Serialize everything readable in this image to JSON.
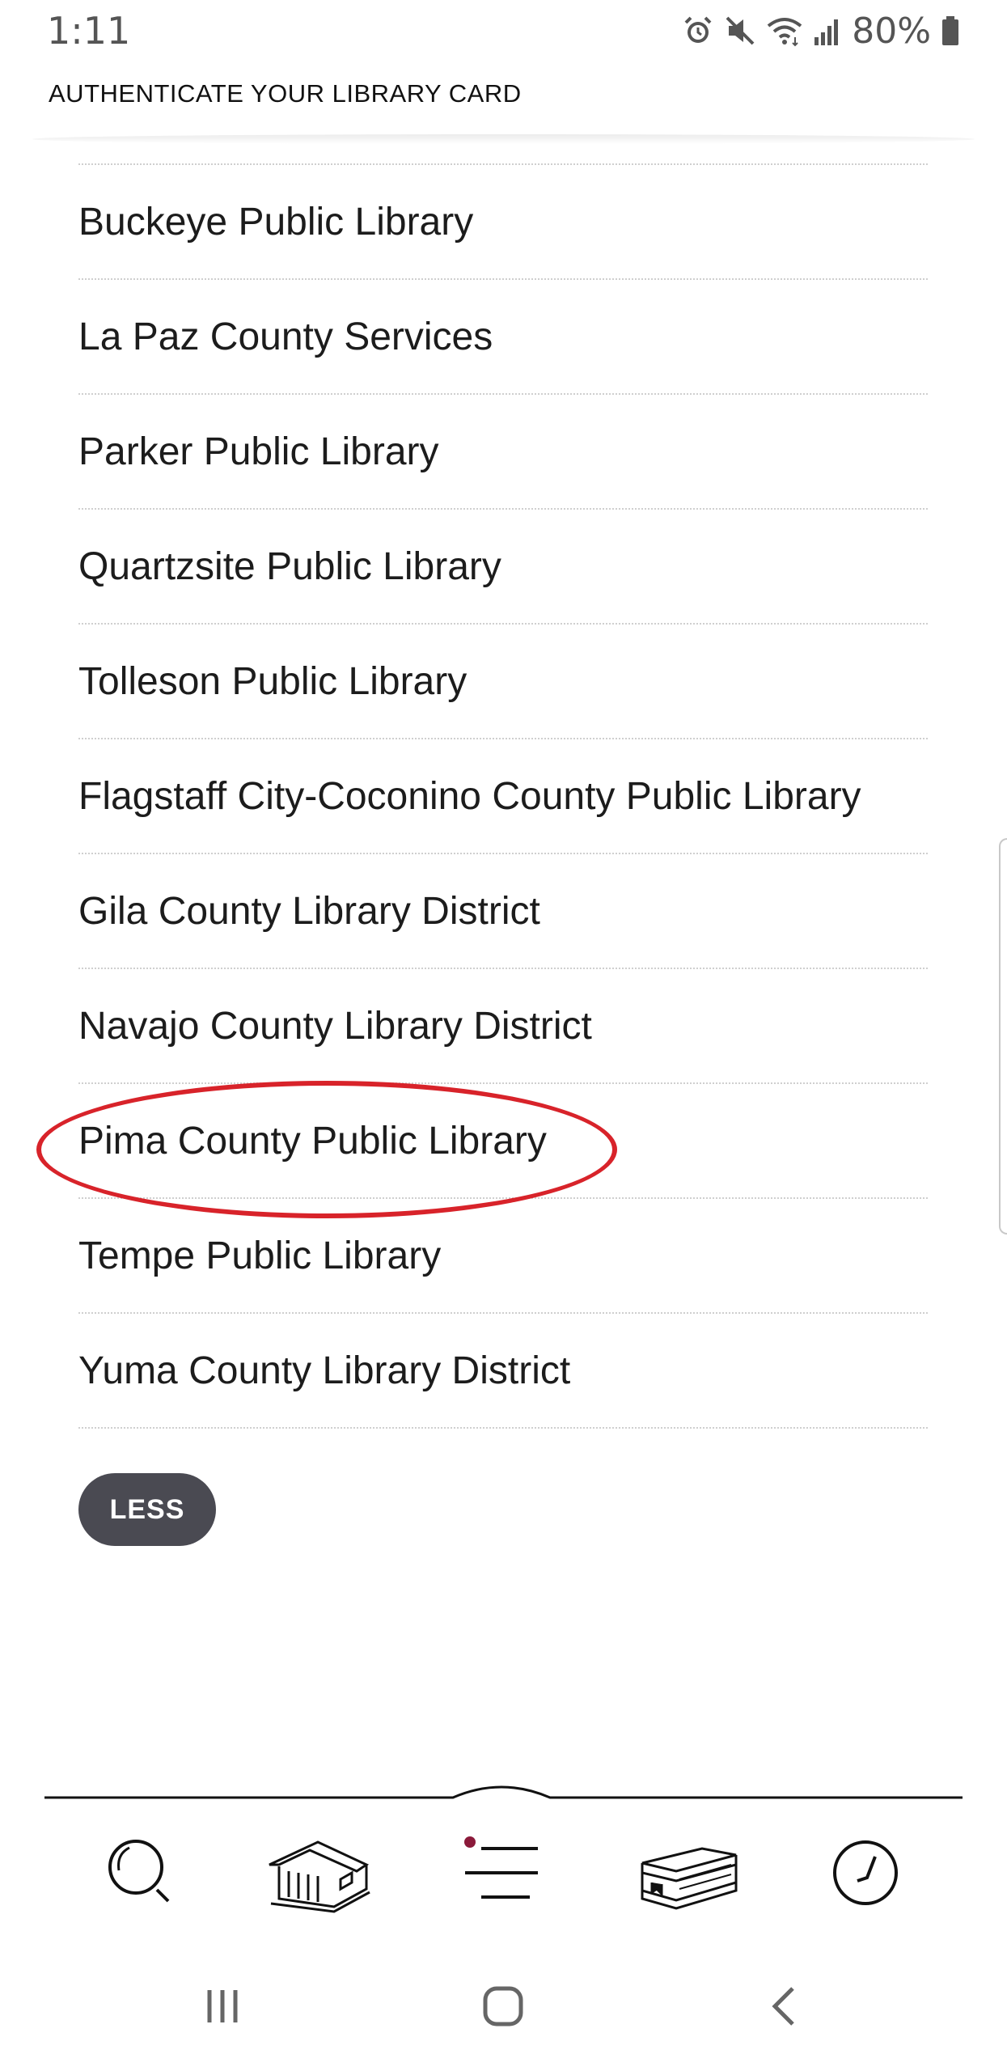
{
  "status_bar": {
    "time": "1:11",
    "battery": "80%"
  },
  "header": {
    "title": "AUTHENTICATE YOUR LIBRARY CARD"
  },
  "libraries": [
    "Buckeye Public Library",
    "La Paz County Services",
    "Parker Public Library",
    "Quartzsite Public Library",
    "Tolleson Public Library",
    "Flagstaff City-Coconino County Public Library",
    "Gila County Library District",
    "Navajo County Library District",
    "Pima County Public Library",
    "Tempe Public Library",
    "Yuma County Library District"
  ],
  "highlighted_library": "Pima County Public Library",
  "less_button_label": "LESS",
  "bottom_nav": {
    "items": [
      "search-icon",
      "library-icon",
      "menu-icon",
      "shelf-icon",
      "clock-icon"
    ],
    "active_indicator_color": "#8b1a3a"
  },
  "system_nav": {
    "items": [
      "recent-apps-icon",
      "home-icon",
      "back-icon"
    ]
  },
  "colors": {
    "highlight_ring": "#d8232a",
    "less_button_bg": "#4a4a52"
  }
}
